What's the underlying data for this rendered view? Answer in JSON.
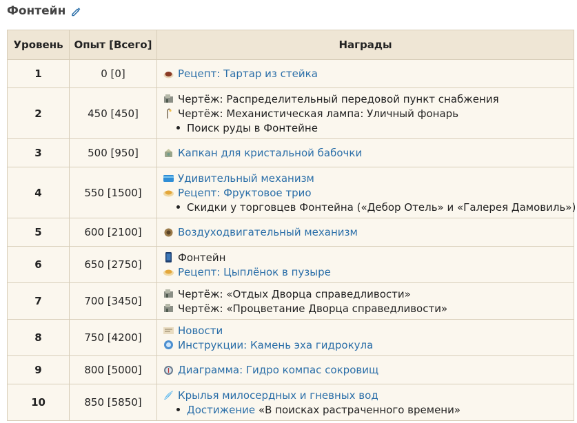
{
  "section": {
    "title": "Фонтейн"
  },
  "table": {
    "headers": [
      "Уровень",
      "Опыт [Всего]",
      "Награды"
    ],
    "rows": [
      {
        "level": "1",
        "exp": "0 [0]",
        "rewards": [
          {
            "kind": "item",
            "icon": "dish-icon",
            "text": "Рецепт: Тартар из стейка",
            "link": true
          }
        ]
      },
      {
        "level": "2",
        "exp": "450 [450]",
        "rewards": [
          {
            "kind": "item",
            "icon": "blueprint-building-icon",
            "text": "Чертёж: Распределительный передовой пункт снабжения",
            "link": false
          },
          {
            "kind": "item",
            "icon": "lamp-icon",
            "text": "Чертёж: Механистическая лампа: Уличный фонарь",
            "link": false
          },
          {
            "kind": "bullet",
            "text": "Поиск руды в Фонтейне"
          }
        ]
      },
      {
        "level": "3",
        "exp": "500 [950]",
        "rewards": [
          {
            "kind": "item",
            "icon": "trap-icon",
            "text": "Капкан для кристальной бабочки",
            "link": true
          }
        ]
      },
      {
        "level": "4",
        "exp": "550 [1500]",
        "rewards": [
          {
            "kind": "item",
            "icon": "card-icon",
            "text": "Удивительный механизм",
            "link": true
          },
          {
            "kind": "item",
            "icon": "dish-plate-icon",
            "text": "Рецепт: Фруктовое трио",
            "link": true
          },
          {
            "kind": "bullet",
            "text": "Скидки у торговцев Фонтейна («Дебор Отель» и «Галерея Дамовиль»)"
          }
        ]
      },
      {
        "level": "5",
        "exp": "600 [2100]",
        "rewards": [
          {
            "kind": "item",
            "icon": "gear-icon",
            "text": "Воздуходвигательный механизм",
            "link": true
          }
        ]
      },
      {
        "level": "6",
        "exp": "650 [2750]",
        "rewards": [
          {
            "kind": "item",
            "icon": "namecard-icon",
            "text": "Фонтейн",
            "link": false
          },
          {
            "kind": "item",
            "icon": "dish-plate-icon",
            "text": "Рецепт: Цыплёнок в пузыре",
            "link": true
          }
        ]
      },
      {
        "level": "7",
        "exp": "700 [3450]",
        "rewards": [
          {
            "kind": "item",
            "icon": "blueprint-building-icon",
            "text": "Чертёж: «Отдых Дворца справедливости»",
            "link": false
          },
          {
            "kind": "item",
            "icon": "blueprint-building-icon",
            "text": "Чертёж: «Процветание Дворца справедливости»",
            "link": false
          }
        ]
      },
      {
        "level": "8",
        "exp": "750 [4200]",
        "rewards": [
          {
            "kind": "item",
            "icon": "news-icon",
            "text": "Новости",
            "link": true
          },
          {
            "kind": "item",
            "icon": "stone-icon",
            "text": "Инструкции: Камень эха гидрокула",
            "link": true
          }
        ]
      },
      {
        "level": "9",
        "exp": "800 [5000]",
        "rewards": [
          {
            "kind": "item",
            "icon": "compass-icon",
            "text": "Диаграмма: Гидро компас сокровищ",
            "link": true
          }
        ]
      },
      {
        "level": "10",
        "exp": "850 [5850]",
        "rewards": [
          {
            "kind": "item",
            "icon": "wings-icon",
            "text": "Крылья милосердных и гневных вод",
            "link": true
          },
          {
            "kind": "bullet-link",
            "link_text": "Достижение",
            "text": " «В поисках растраченного времени»"
          }
        ]
      }
    ]
  },
  "colors": {
    "link": "#2a6ea8",
    "header_bg": "#efe6d5",
    "cell_bg": "#fbf7ee",
    "border": "#d7cdb8"
  }
}
